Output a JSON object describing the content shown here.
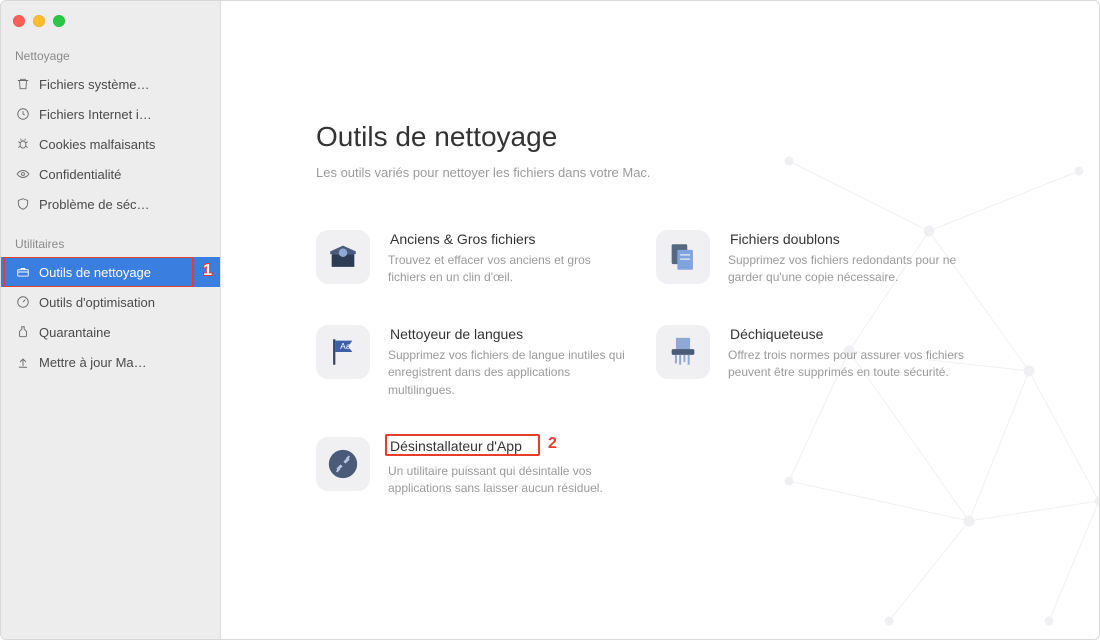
{
  "sidebar": {
    "sections": [
      {
        "header": "Nettoyage",
        "items": [
          {
            "icon": "trash-icon",
            "label": "Fichiers système…"
          },
          {
            "icon": "clock-icon",
            "label": "Fichiers Internet i…"
          },
          {
            "icon": "bug-icon",
            "label": "Cookies malfaisants"
          },
          {
            "icon": "eye-icon",
            "label": "Confidentialité"
          },
          {
            "icon": "shield-icon",
            "label": "Problème de séc…"
          }
        ]
      },
      {
        "header": "Utilitaires",
        "items": [
          {
            "icon": "toolbox-icon",
            "label": "Outils de nettoyage",
            "selected": true
          },
          {
            "icon": "gauge-icon",
            "label": "Outils d'optimisation"
          },
          {
            "icon": "jar-icon",
            "label": "Quarantaine"
          },
          {
            "icon": "upload-icon",
            "label": "Mettre à jour Ma…"
          }
        ]
      }
    ]
  },
  "annotations": {
    "sidebar_badge": "1",
    "tool_badge": "2"
  },
  "main": {
    "title": "Outils de nettoyage",
    "subtitle": "Les outils variés pour nettoyer les fichiers dans votre Mac."
  },
  "tools": [
    {
      "icon": "box-icon",
      "title": "Anciens & Gros fichiers",
      "desc": "Trouvez et effacer vos anciens et gros fichiers en un clin d'œil."
    },
    {
      "icon": "docs-icon",
      "title": "Fichiers doublons",
      "desc": "Supprimez vos fichiers redondants pour ne garder qu'une copie nécessaire."
    },
    {
      "icon": "flag-icon",
      "title": "Nettoyeur de langues",
      "desc": "Supprimez vos fichiers de langue inutiles qui enregistrent dans des applications multilingues."
    },
    {
      "icon": "shredder-icon",
      "title": "Déchiqueteuse",
      "desc": "Offrez trois normes pour assurer vos fichiers peuvent être supprimés en toute sécurité."
    },
    {
      "icon": "wrench-icon",
      "title": "Désinstallateur d'App",
      "desc": "Un utilitaire puissant qui désintalle vos applications sans laisser aucun résiduel."
    }
  ]
}
